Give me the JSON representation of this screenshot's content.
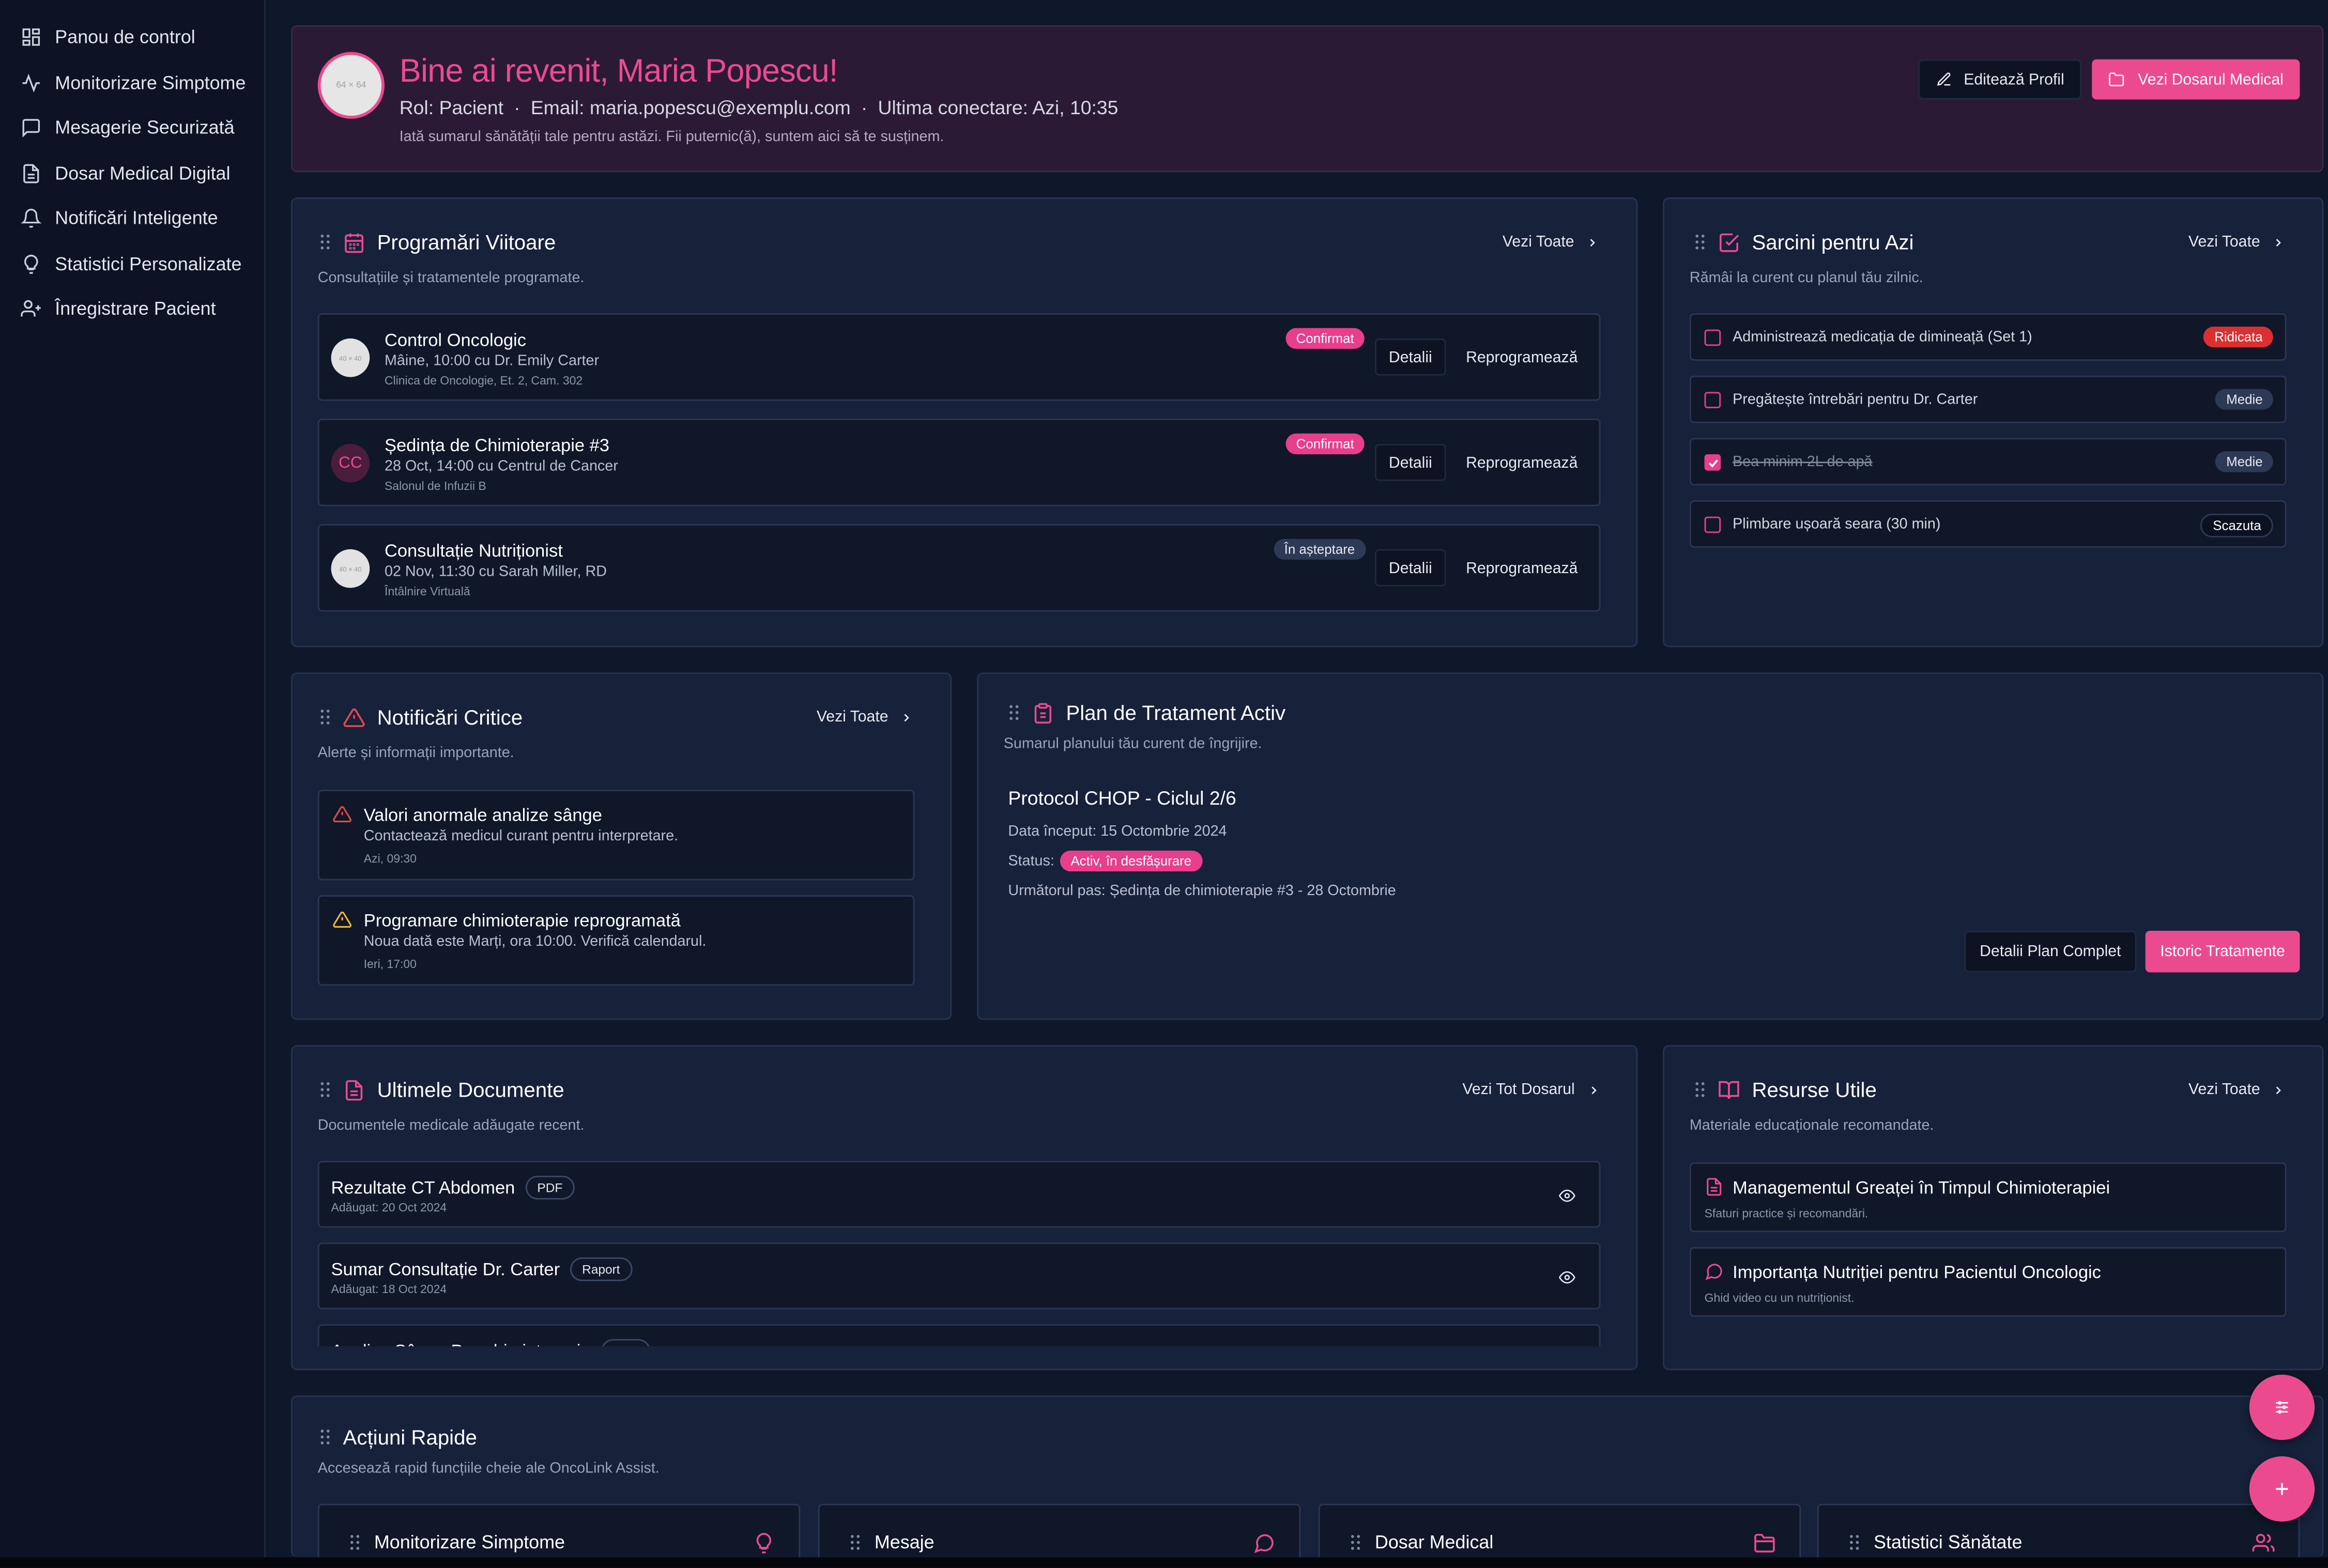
{
  "sidebar": {
    "items": [
      {
        "label": "Panou de control",
        "icon": "dashboard-icon"
      },
      {
        "label": "Monitorizare Simptome",
        "icon": "activity-icon"
      },
      {
        "label": "Mesagerie Securizată",
        "icon": "message-icon"
      },
      {
        "label": "Dosar Medical Digital",
        "icon": "document-icon"
      },
      {
        "label": "Notificări Inteligente",
        "icon": "bell-icon"
      },
      {
        "label": "Statistici Personalizate",
        "icon": "lightbulb-icon"
      },
      {
        "label": "Înregistrare Pacient",
        "icon": "user-plus-icon"
      }
    ]
  },
  "welcome": {
    "avatar": "64 × 64",
    "title": "Bine ai revenit, Maria Popescu!",
    "role": "Rol: Pacient",
    "email": "Email: maria.popescu@exemplu.com",
    "last": "Ultima conectare: Azi, 10:35",
    "sep": "·",
    "message": "Iată sumarul sănătății tale pentru astăzi. Fii puternic(ă), suntem aici să te susținem.",
    "edit": "Editează Profil",
    "record": "Vezi Dosarul Medical"
  },
  "appointments": {
    "title": "Programări Viitoare",
    "subtitle": "Consultațiile și tratamentele programate.",
    "view_all": "Vezi Toate",
    "details": "Detalii",
    "reschedule": "Reprogramează",
    "items": [
      {
        "title": "Control Oncologic",
        "when": "Mâine, 10:00 cu Dr. Emily Carter",
        "where": "Clinica de Oncologie, Et. 2, Cam. 302",
        "status": "Confirmat",
        "avatar": "40 × 40"
      },
      {
        "title": "Ședința de Chimioterapie #3",
        "when": "28 Oct, 14:00 cu Centrul de Cancer",
        "where": "Salonul de Infuzii B",
        "status": "Confirmat",
        "avatar": "CC"
      },
      {
        "title": "Consultație Nutriționist",
        "when": "02 Nov, 11:30 cu Sarah Miller, RD",
        "where": "Întâlnire Virtuală",
        "status": "În așteptare",
        "avatar": "40 × 40"
      }
    ]
  },
  "tasks": {
    "title": "Sarcini pentru Azi",
    "subtitle": "Rămâi la curent cu planul tău zilnic.",
    "view_all": "Vezi Toate",
    "items": [
      {
        "label": "Administrează medicația de dimineață (Set 1)",
        "priority": "Ridicata",
        "done": false
      },
      {
        "label": "Pregătește întrebări pentru Dr. Carter",
        "priority": "Medie",
        "done": false
      },
      {
        "label": "Bea minim 2L de apă",
        "priority": "Medie",
        "done": true
      },
      {
        "label": "Plimbare ușoară seara (30 min)",
        "priority": "Scazuta",
        "done": false
      }
    ]
  },
  "alerts": {
    "title": "Notificări Critice",
    "subtitle": "Alerte și informații importante.",
    "view_all": "Vezi Toate",
    "items": [
      {
        "title": "Valori anormale analize sânge",
        "text": "Contactează medicul curant pentru interpretare.",
        "time": "Azi, 09:30",
        "color": "#e5484d"
      },
      {
        "title": "Programare chimioterapie reprogramată",
        "text": "Noua dată este Marți, ora 10:00. Verifică calendarul.",
        "time": "Ieri, 17:00",
        "color": "#f5b82e"
      }
    ]
  },
  "plan": {
    "title": "Plan de Tratament Activ",
    "subtitle": "Sumarul planului tău curent de îngrijire.",
    "protocol": "Protocol CHOP - Ciclul 2/6",
    "start": "Data început: 15 Octombrie 2024",
    "status_label": "Status:",
    "status": "Activ, în desfășurare",
    "next": "Următorul pas: Ședința de chimioterapie #3 - 28 Octombrie",
    "details": "Detalii Plan Complet",
    "history": "Istoric Tratamente"
  },
  "documents": {
    "title": "Ultimele Documente",
    "subtitle": "Documentele medicale adăugate recent.",
    "view_all": "Vezi Tot Dosarul",
    "items": [
      {
        "name": "Rezultate CT Abdomen",
        "type": "PDF",
        "date": "Adăugat: 20 Oct 2024"
      },
      {
        "name": "Sumar Consultație Dr. Carter",
        "type": "Raport",
        "date": "Adăugat: 18 Oct 2024"
      },
      {
        "name": "Analize Sânge Pre-chimioterapie",
        "type": "PDF",
        "date": ""
      }
    ]
  },
  "resources": {
    "title": "Resurse Utile",
    "subtitle": "Materiale educaționale recomandate.",
    "view_all": "Vezi Toate",
    "items": [
      {
        "title": "Managementul Greaței în Timpul Chimioterapiei",
        "text": "Sfaturi practice și recomandări."
      },
      {
        "title": "Importanța Nutriției pentru Pacientul Oncologic",
        "text": "Ghid video cu un nutriționist."
      }
    ]
  },
  "quick": {
    "title": "Acțiuni Rapide",
    "subtitle": "Accesează rapid funcțiile cheie ale OncoLink Assist.",
    "items": [
      {
        "label": "Monitorizare Simptome",
        "icon": "lightbulb-icon"
      },
      {
        "label": "Mesaje",
        "icon": "message-icon"
      },
      {
        "label": "Dosar Medical",
        "icon": "folder-icon"
      },
      {
        "label": "Statistici Sănătate",
        "icon": "users-icon"
      }
    ]
  },
  "colors": {
    "accent": "#ec4a8f",
    "background": "#0f172a",
    "card": "#16213a",
    "critical": "#dc2f2f"
  }
}
